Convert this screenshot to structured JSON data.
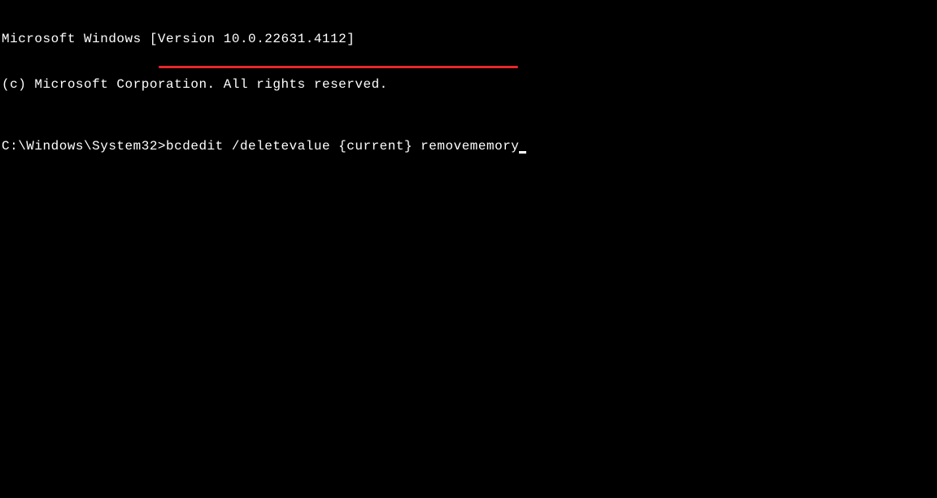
{
  "terminal": {
    "header_line1": "Microsoft Windows [Version 10.0.22631.4112]",
    "header_line2": "(c) Microsoft Corporation. All rights reserved.",
    "prompt": "C:\\Windows\\System32>",
    "command": "bcdedit /deletevalue {current} removememory"
  }
}
